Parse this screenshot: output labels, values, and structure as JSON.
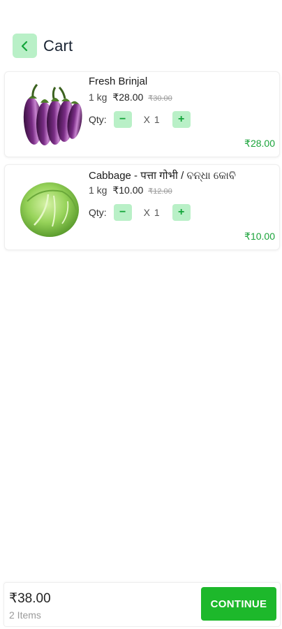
{
  "header": {
    "title": "Cart",
    "back_icon": "chevron-left-icon"
  },
  "items": [
    {
      "name": "Fresh Brinjal",
      "unit": "1 kg",
      "price": "₹28.00",
      "mrp": "₹30.00",
      "qty_label": "Qty:",
      "qty": "X 1",
      "total": "₹28.00",
      "image_icon": "brinjal-image"
    },
    {
      "name": "Cabbage - पत्ता गोभी / ବନ୍ଧା କୋବି",
      "unit": "1 kg",
      "price": "₹10.00",
      "mrp": "₹12.00",
      "qty_label": "Qty:",
      "qty": "X 1",
      "total": "₹10.00",
      "image_icon": "cabbage-image"
    }
  ],
  "summary": {
    "total": "₹38.00",
    "items_count": "2 Items",
    "continue_label": "CONTINUE"
  },
  "colors": {
    "accent": "#1db82b",
    "accent_light": "#b9f0c7",
    "price_green": "#1aa33a"
  }
}
